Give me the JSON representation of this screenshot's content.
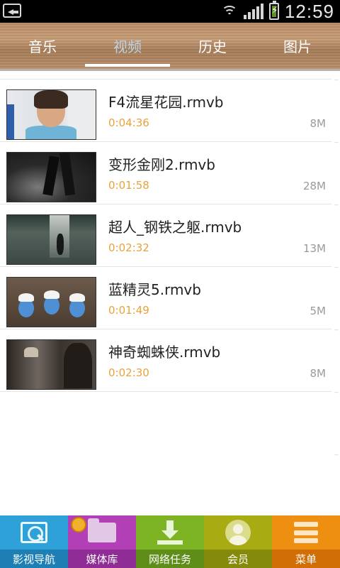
{
  "status_bar": {
    "time": "12:59",
    "icons": [
      "back-icon",
      "wifi-icon",
      "signal-icon",
      "battery-charging-icon"
    ]
  },
  "tabs": [
    {
      "label": "音乐",
      "active": false
    },
    {
      "label": "视频",
      "active": true
    },
    {
      "label": "历史",
      "active": false
    },
    {
      "label": "图片",
      "active": false
    }
  ],
  "videos": [
    {
      "title": "F4流星花园.rmvb",
      "duration": "0:04:36",
      "size": "8M"
    },
    {
      "title": "变形金刚2.rmvb",
      "duration": "0:01:58",
      "size": "28M"
    },
    {
      "title": "超人_钢铁之躯.rmvb",
      "duration": "0:02:32",
      "size": "13M"
    },
    {
      "title": "蓝精灵5.rmvb",
      "duration": "0:01:49",
      "size": "5M"
    },
    {
      "title": "神奇蜘蛛侠.rmvb",
      "duration": "0:02:30",
      "size": "8M"
    }
  ],
  "bottom_nav": [
    {
      "label": "影视导航",
      "icon": "film-search-icon",
      "color": "#2fa1d9"
    },
    {
      "label": "媒体库",
      "icon": "folder-icon",
      "color": "#b23fb6"
    },
    {
      "label": "网络任务",
      "icon": "download-icon",
      "color": "#7cb424"
    },
    {
      "label": "会员",
      "icon": "user-icon",
      "color": "#a8ab12"
    },
    {
      "label": "菜单",
      "icon": "menu-icon",
      "color": "#ee8f12"
    }
  ],
  "colors": {
    "accent_duration": "#e8a23a",
    "active_tab": "#b9d4e8"
  }
}
